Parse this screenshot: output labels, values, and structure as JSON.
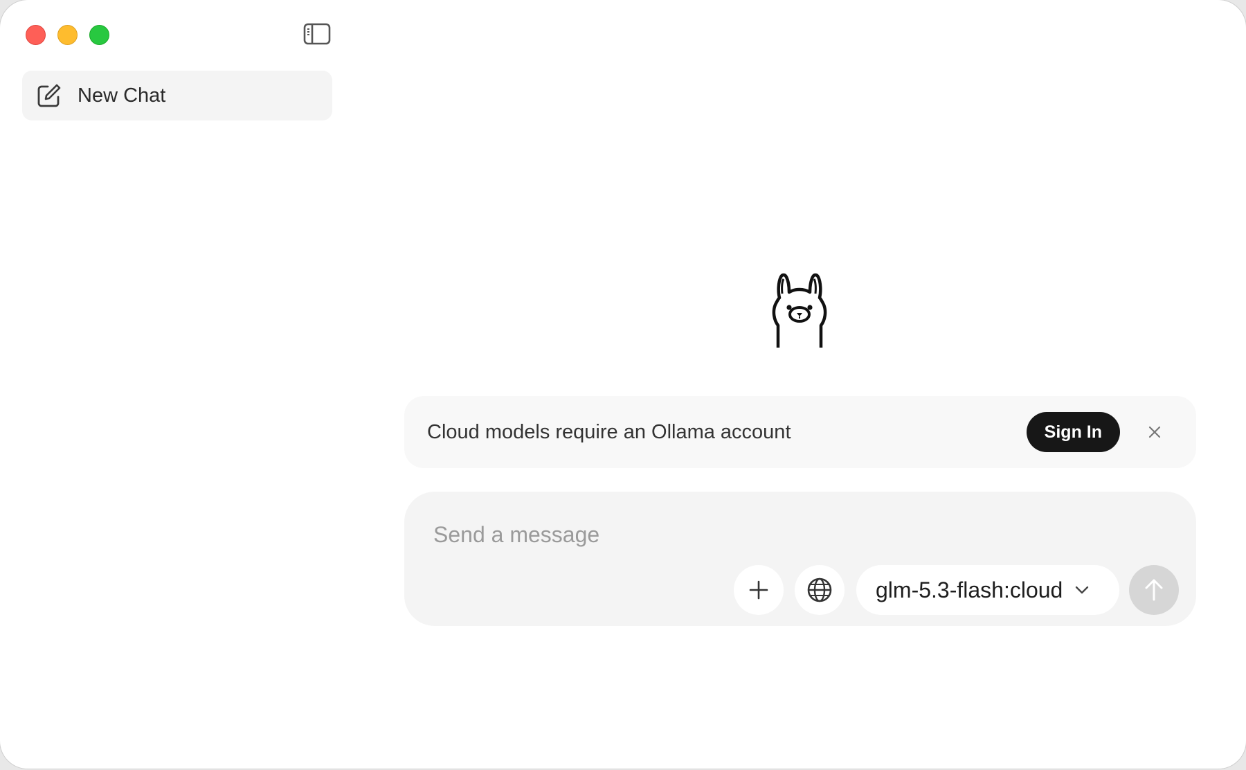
{
  "window": {
    "controls": [
      "close",
      "minimize",
      "maximize"
    ]
  },
  "sidebar": {
    "toggle_icon": "sidebar-icon",
    "new_chat_label": "New Chat",
    "new_chat_icon": "compose-icon"
  },
  "main": {
    "logo_icon": "ollama-llama-icon",
    "banner": {
      "message": "Cloud models require an Ollama account",
      "sign_in_label": "Sign In",
      "dismiss_icon": "close-icon"
    },
    "composer": {
      "placeholder": "Send a message",
      "add_icon": "plus-icon",
      "web_search_icon": "globe-icon",
      "model": "glm-5.3-flash:cloud",
      "model_dropdown_icon": "chevron-down-icon",
      "send_icon": "arrow-up-icon"
    }
  },
  "colors": {
    "close": "#fe5f57",
    "minimize": "#febc2e",
    "maximize": "#28c840",
    "sign_in_bg": "#171717",
    "send_disabled": "#d6d6d6"
  }
}
